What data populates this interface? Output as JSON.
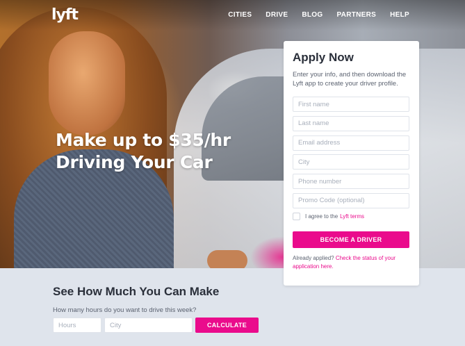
{
  "brand": {
    "logo_text": "lyft",
    "accent_color": "#ea0b8c"
  },
  "nav": {
    "items": [
      "CITIES",
      "DRIVE",
      "BLOG",
      "PARTNERS",
      "HELP"
    ]
  },
  "hero": {
    "headline_line1": "Make up to $35/hr",
    "headline_line2": "Driving Your Car"
  },
  "apply": {
    "title": "Apply Now",
    "intro": "Enter your info, and then download the Lyft app to create your driver profile.",
    "fields": {
      "first_name": "First name",
      "last_name": "Last name",
      "email": "Email address",
      "city": "City",
      "phone": "Phone number",
      "promo": "Promo Code (optional)"
    },
    "agree_text": "I agree to the ",
    "agree_link": "Lyft terms",
    "button": "BECOME A DRIVER",
    "already_text": "Already applied? ",
    "already_link": "Check the status of your application here."
  },
  "calculator": {
    "title": "See How Much You Can Make",
    "question": "How many hours do you want to drive this week?",
    "hours_placeholder": "Hours",
    "city_placeholder": "City",
    "button": "CALCULATE"
  }
}
